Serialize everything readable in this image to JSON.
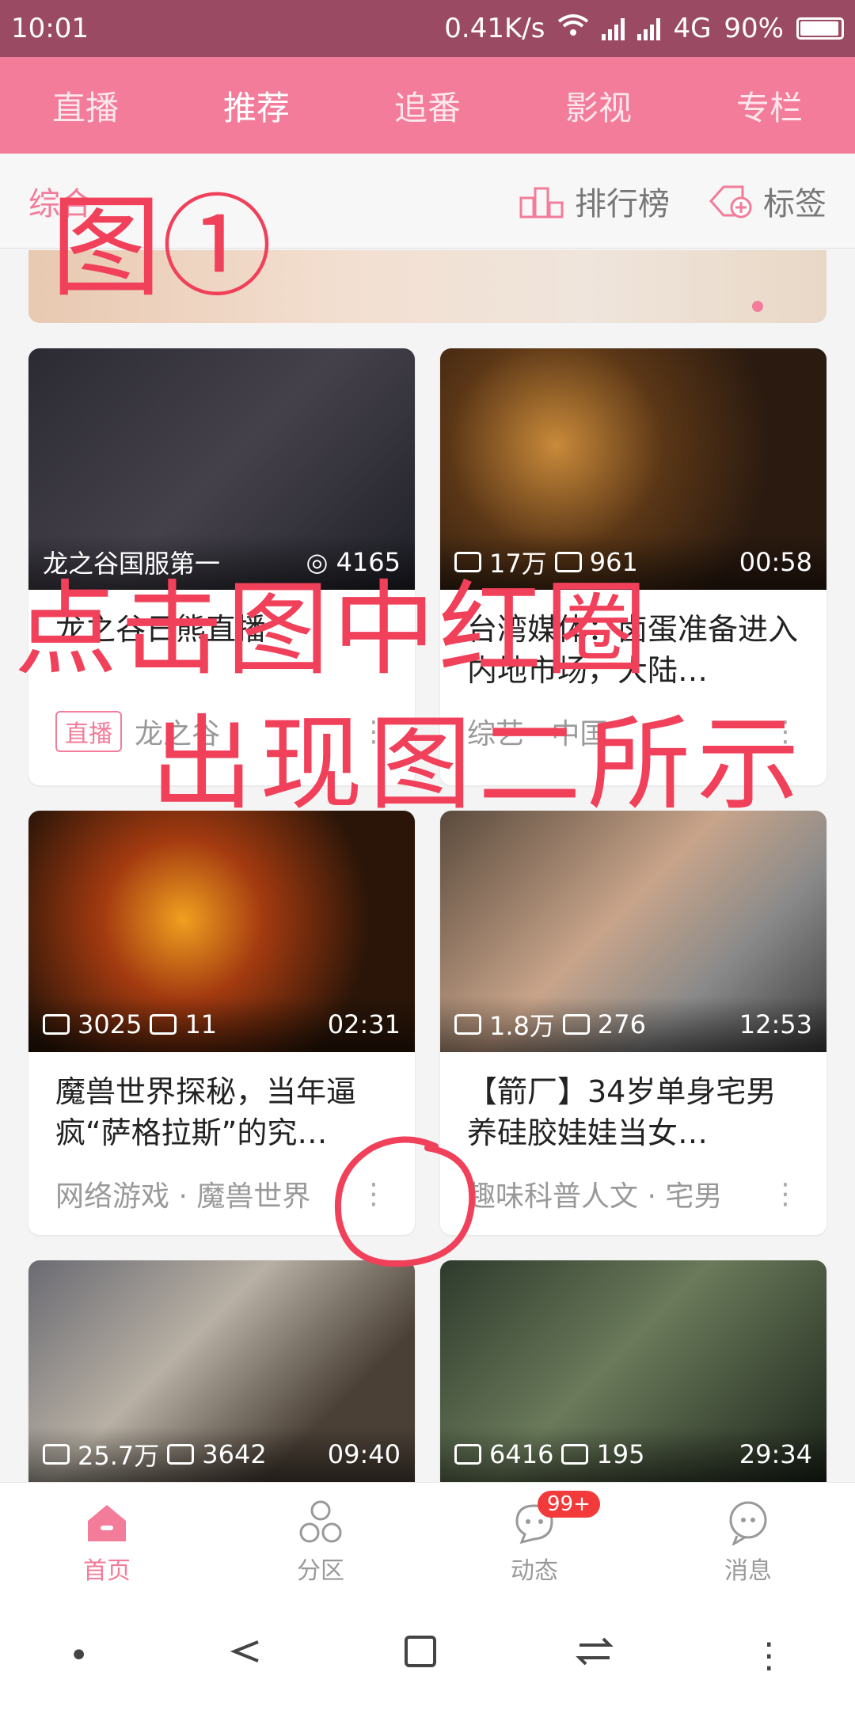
{
  "status": {
    "time": "10:01",
    "speed": "0.41K/s",
    "network": "4G",
    "battery": "90%"
  },
  "top_tabs": [
    "直播",
    "推荐",
    "追番",
    "影视",
    "专栏"
  ],
  "active_tab": 1,
  "subnav": {
    "left": "综合",
    "ranking": "排行榜",
    "tags": "标签"
  },
  "cards": [
    {
      "views": "",
      "comments": "4165",
      "duration": "",
      "overlay_left": "龙之谷国服第一",
      "title": "龙之谷日熊直播",
      "category": "龙之谷",
      "badge": "直播"
    },
    {
      "views": "17万",
      "comments": "961",
      "duration": "00:58",
      "title": "台湾媒体：卤蛋准备进入内地市场，大陆…",
      "category": "综艺 · 中国"
    },
    {
      "views": "3025",
      "comments": "11",
      "duration": "02:31",
      "title": "魔兽世界探秘，当年逼疯“萨格拉斯”的究…",
      "category": "网络游戏 · 魔兽世界"
    },
    {
      "views": "1.8万",
      "comments": "276",
      "duration": "12:53",
      "title": "【箭厂】34岁单身宅男养硅胶娃娃当女…",
      "category": "趣味科普人文 · 宅男"
    },
    {
      "views": "25.7万",
      "comments": "3642",
      "duration": "09:40"
    },
    {
      "views": "6416",
      "comments": "195",
      "duration": "29:34"
    }
  ],
  "bottom_nav": [
    {
      "label": "首页",
      "icon": "home-icon"
    },
    {
      "label": "分区",
      "icon": "category-icon"
    },
    {
      "label": "动态",
      "icon": "dynamic-icon",
      "badge": "99+"
    },
    {
      "label": "消息",
      "icon": "message-icon"
    }
  ],
  "annotations": {
    "fig": "图①",
    "line1": "点击图中红圈",
    "line2": "出现图二所示"
  },
  "colors": {
    "accent": "#f27c9a",
    "status_bar": "#9b4a63",
    "annotation": "#f0405a"
  }
}
